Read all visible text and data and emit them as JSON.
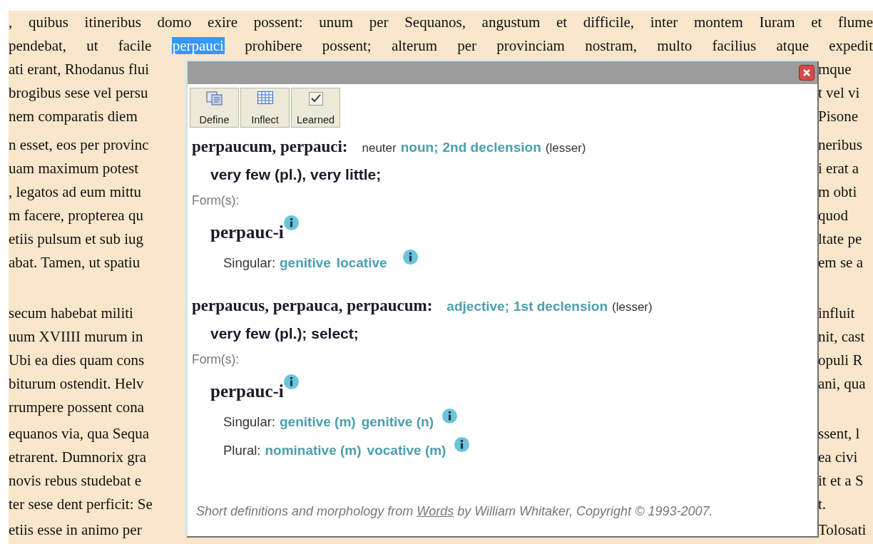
{
  "document": {
    "paragraphs": [
      {
        "lines": [
          {
            "kind": "full",
            "segments": [
              {
                "text": ", quibus itineribus domo exire possent: unum per Sequanos, angustum et difficile, inter montem Iuram et flume",
                "selected": false
              }
            ]
          },
          {
            "kind": "full",
            "segments": [
              {
                "text": "pendebat, ut facile",
                "selected": false
              },
              {
                "text": "perpauci",
                "selected": true
              },
              {
                "text": "prohibere possent; alterum per provinciam nostram, multo facilius atque expedit",
                "selected": false
              }
            ]
          },
          {
            "kind": "split",
            "left": "ati erant, Rhodanus flui",
            "right": "mque"
          },
          {
            "kind": "split",
            "left": "brogibus sese vel persu",
            "right": "t vel vi"
          },
          {
            "kind": "split",
            "left": "nem comparatis diem",
            "right": "Pisone"
          }
        ]
      },
      {
        "lines": [
          {
            "kind": "split",
            "left": "n esset, eos per provinc",
            "right": "neribus"
          },
          {
            "kind": "split",
            "left": "uam maximum potest",
            "right": "i erat a"
          },
          {
            "kind": "split",
            "left": ", legatos ad eum mittu",
            "right": "m obti"
          },
          {
            "kind": "split",
            "left": "m facere, propterea qu",
            "right": "quod"
          },
          {
            "kind": "split",
            "left": "etiis pulsum et sub iug",
            "right": "ltate pe"
          },
          {
            "kind": "split",
            "left": "abat. Tamen, ut spatiu",
            "right": "em se a"
          }
        ]
      },
      {
        "lines": [
          {
            "kind": "split",
            "left": "secum habebat militi",
            "right": "influit"
          },
          {
            "kind": "split",
            "left": "uum XVIIII murum in",
            "right": "nit, cast"
          },
          {
            "kind": "split",
            "left": "Ubi ea dies quam cons",
            "right": "opuli R"
          },
          {
            "kind": "split",
            "left": "biturum ostendit. Helv",
            "right": "ani, qua"
          },
          {
            "kind": "split",
            "left": "rrumpere possent cona"
          }
        ]
      },
      {
        "lines": [
          {
            "kind": "split",
            "left": "equanos via, qua Sequa",
            "right": "ssent, l"
          },
          {
            "kind": "split",
            "left": "etrarent. Dumnorix gra",
            "right": "ea civi"
          },
          {
            "kind": "split",
            "left": "novis rebus studebat e",
            "right": "it et a S"
          },
          {
            "kind": "split",
            "left": "ter sese dent perficit: Se",
            "right": "t."
          }
        ]
      },
      {
        "lines": [
          {
            "kind": "split",
            "left": "etiis esse in animo per",
            "right": "Tolosati"
          }
        ]
      }
    ]
  },
  "popup": {
    "toolbar": [
      {
        "kind": "define",
        "label": "Define"
      },
      {
        "kind": "inflect",
        "label": "Inflect"
      },
      {
        "kind": "learned",
        "label": "Learned"
      }
    ],
    "entries": [
      {
        "headword": "perpaucum, perpauci:",
        "gender": "neuter",
        "pos": [
          "noun;",
          "2nd declension"
        ],
        "note": "(lesser)",
        "definition": "very few (pl.), very little;",
        "forms_label": "Form(s):",
        "forms": [
          {
            "stem": "perpauc-i",
            "inflections": [
              {
                "label": "Singular:",
                "cases": [
                  "genitive",
                  "locative"
                ]
              }
            ]
          }
        ]
      },
      {
        "headword": "perpaucus, perpauca, perpaucum:",
        "pos": [
          "adjective;",
          "1st declension"
        ],
        "note": "(lesser)",
        "definition": "very few (pl.); select;",
        "forms_label": "Form(s):",
        "forms": [
          {
            "stem": "perpauc-i",
            "inflections": [
              {
                "label": "Singular:",
                "cases": [
                  "genitive (m)",
                  "genitive (n)"
                ]
              },
              {
                "label": "Plural:",
                "cases": [
                  "nominative (m)",
                  "vocative (m)"
                ]
              }
            ]
          }
        ]
      }
    ],
    "footer": {
      "before": "Short definitions and morphology from",
      "link": "Words",
      "after": "by William Whitaker, Copyright © 1993-2007."
    }
  }
}
